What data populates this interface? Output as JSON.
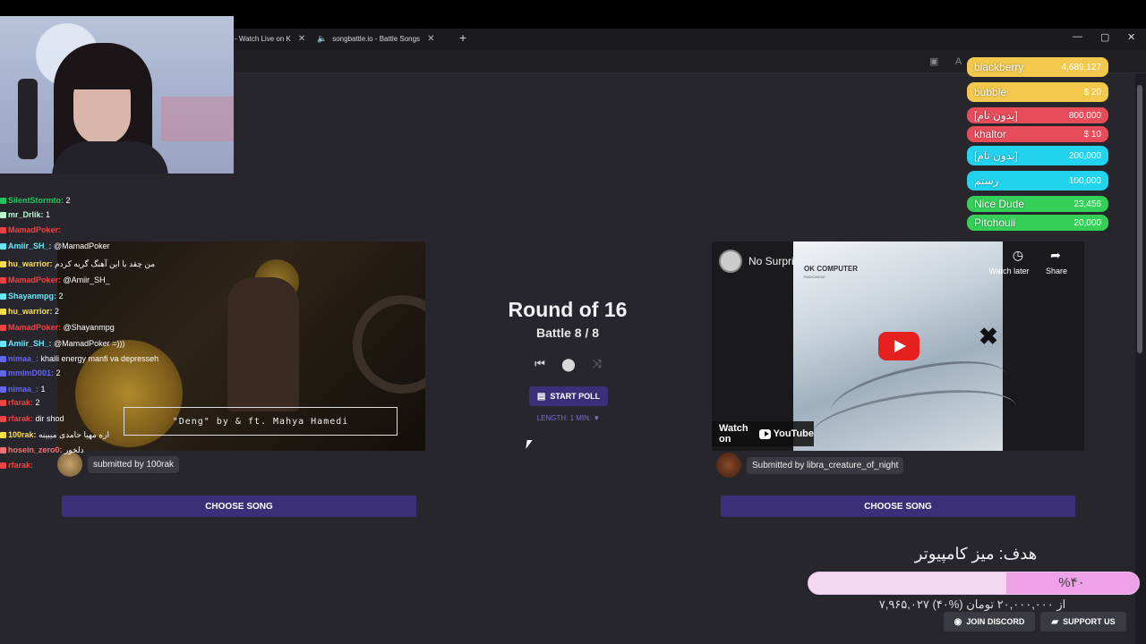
{
  "browser": {
    "tabs": [
      {
        "label": "- Watch Live on K",
        "close": "✕"
      },
      {
        "label": "songbattle.io - Battle Songs",
        "close": "✕"
      }
    ],
    "new_tab": "+",
    "window_controls": {
      "minimize": "—",
      "maximize": "▢",
      "close": "✕"
    }
  },
  "round": {
    "title": "Round of 16",
    "battle": "Battle 8 / 8",
    "controls": {
      "previous": "⏮",
      "stats": "⬤",
      "shuffle": "⤨"
    },
    "start_poll_label": "START POLL",
    "length_label": "LENGTH: 1 MIN. ▼"
  },
  "left_song": {
    "caption": "\"Deng\" by & ft. Mahya Hamedi",
    "submitted_by": "submitted by 100rak",
    "choose_label": "CHOOSE SONG"
  },
  "right_song": {
    "video_title": "No Surprises",
    "album_title": "OK COMPUTER",
    "album_sub": "RADIOHEAD",
    "watch_later": "Watch later",
    "share": "Share",
    "watch_on": "Watch on",
    "youtube": "YouTube",
    "submitted_by": "Submitted by libra_creature_of_night",
    "choose_label": "CHOOSE SONG"
  },
  "chat": [
    {
      "user": "SilentStormto",
      "msg": "2",
      "color": "#22c55e"
    },
    {
      "user": "mr_Drlik",
      "msg": "1",
      "color": "#bbf7d0"
    },
    {
      "user": "MamadPoker",
      "msg": "",
      "color": "#ef4444"
    },
    {
      "user": "Amiir_SH_",
      "msg": "@MamadPoker",
      "color": "#67e8f9"
    },
    {
      "user": "hu_warrior",
      "msg": "من چقد با این آهنگ گریه کردم",
      "color": "#fde047"
    },
    {
      "user": "MamadPoker",
      "msg": "@Amiir_SH_",
      "color": "#ef4444"
    },
    {
      "user": "Shayanmpg",
      "msg": "2",
      "color": "#67e8f9"
    },
    {
      "user": "hu_warrior",
      "msg": "2",
      "color": "#fde047"
    },
    {
      "user": "MamadPoker",
      "msg": "@Shayanmpg",
      "color": "#ef4444"
    },
    {
      "user": "Amiir_SH_",
      "msg": "@MamadPoker =)))",
      "color": "#67e8f9"
    },
    {
      "user": "nimaa_",
      "msg": "khaili energy manfi va depresseh",
      "color": "#6366f1"
    },
    {
      "user": "mmlmD001",
      "msg": "2",
      "color": "#6366f1"
    },
    {
      "user": "nimaa_",
      "msg": "1",
      "color": "#6366f1"
    },
    {
      "user": "rfarak",
      "msg": "2",
      "color": "#ef4444"
    },
    {
      "user": "rfarak",
      "msg": "dir shod",
      "color": "#ef4444"
    },
    {
      "user": "100rak",
      "msg": "اره مهیا حامدی میبینه",
      "color": "#fde047"
    },
    {
      "user": "hosein_zero0",
      "msg": "دلخور",
      "color": "#f87171"
    },
    {
      "user": "rfarak",
      "msg": "",
      "color": "#ef4444"
    }
  ],
  "leaderboard": [
    {
      "name": "blackberry",
      "amount": "4,689,127",
      "color": "#f2c94c"
    },
    {
      "name": "bubble",
      "amount": "$ 20",
      "color": "#f2c94c"
    },
    {
      "name": "[بدون نام]",
      "amount": "800,000",
      "color": "#e74c5a"
    },
    {
      "name": "khaltor",
      "amount": "$ 10",
      "color": "#e74c5a"
    },
    {
      "name": "[بدون نام]",
      "amount": "200,000",
      "color": "#22d3ee"
    },
    {
      "name": "رستم",
      "amount": "100,000",
      "color": "#22d3ee"
    },
    {
      "name": "Nice Dude",
      "amount": "23,456",
      "color": "#34d058"
    },
    {
      "name": "Pitohouii",
      "amount": "20,000",
      "color": "#34d058"
    }
  ],
  "goal": {
    "title": "هدف: میز کامپیوتر",
    "percent_label": "%۴۰",
    "progress": 0.4,
    "text": "۷,۹۶۵,۰۲۷ از ۲۰,۰۰۰,۰۰۰ تومان (%۴۰)"
  },
  "footer": {
    "discord_label": "JOIN DISCORD",
    "support_label": "SUPPORT US"
  },
  "colors": {
    "accent": "#3c2f7a",
    "background": "#27262d",
    "goal_fill": "#eea1e6"
  }
}
